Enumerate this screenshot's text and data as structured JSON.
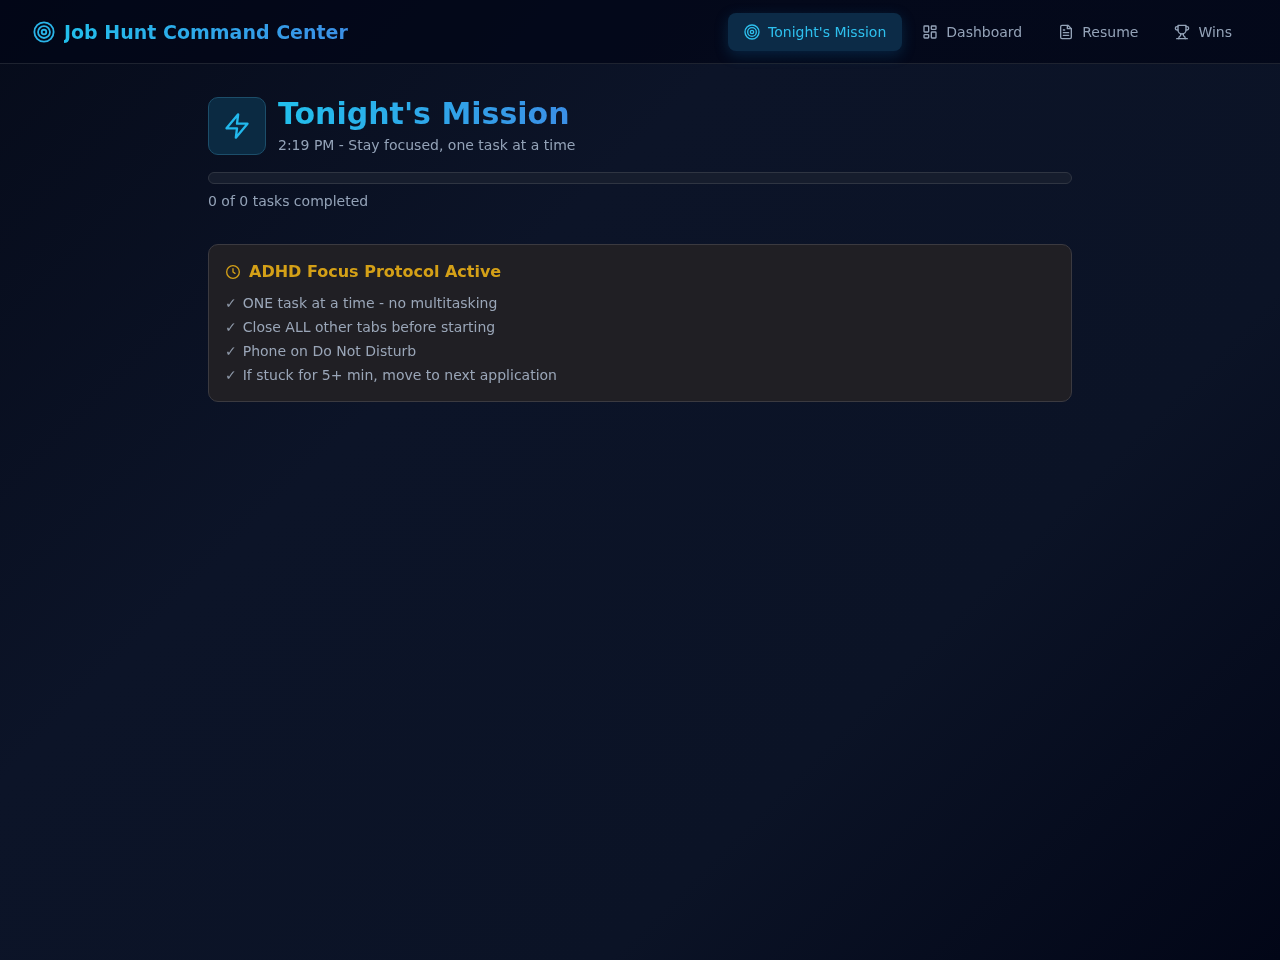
{
  "app": {
    "title": "Job Hunt Command Center"
  },
  "nav": [
    {
      "label": "Tonight's Mission",
      "selected": true
    },
    {
      "label": "Dashboard",
      "selected": false
    },
    {
      "label": "Resume",
      "selected": false
    },
    {
      "label": "Wins",
      "selected": false
    }
  ],
  "mission": {
    "title": "Tonight's Mission",
    "subtitle": "2:19 PM - Stay focused, one task at a time",
    "progress": {
      "level": 0,
      "caption": "0 of 0 tasks completed"
    }
  },
  "protocol": {
    "title": "ADHD Focus Protocol Active",
    "rules": [
      {
        "mark": "✓",
        "text": "ONE task at a time - no multitasking"
      },
      {
        "mark": "✓",
        "text": "Close ALL other tabs before starting"
      },
      {
        "mark": "✓",
        "text": "Phone on Do Not Disturb"
      },
      {
        "mark": "✓",
        "text": "If stuck for 5+ min, move to next application"
      }
    ]
  }
}
